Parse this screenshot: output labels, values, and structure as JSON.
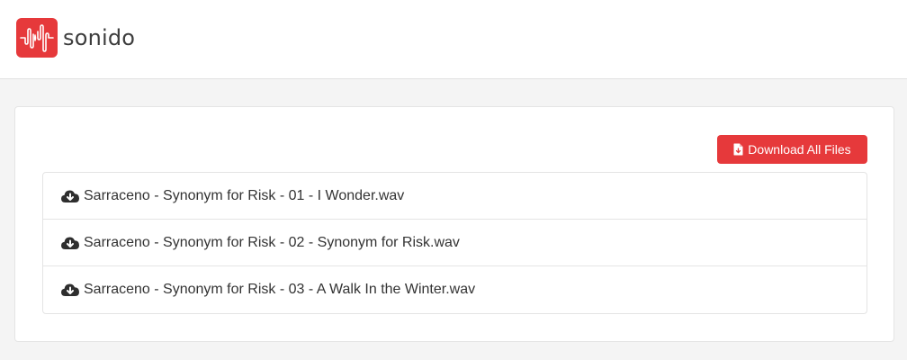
{
  "brand": {
    "name": "sonido",
    "accent_color": "#e6393b"
  },
  "actions": {
    "download_all_label": "Download All Files",
    "download_all_icon": "file-icon"
  },
  "files": [
    {
      "name": "Sarraceno - Synonym for Risk - 01 - I Wonder.wav",
      "icon": "cloud-download-icon"
    },
    {
      "name": "Sarraceno - Synonym for Risk - 02 - Synonym for Risk.wav",
      "icon": "cloud-download-icon"
    },
    {
      "name": "Sarraceno - Synonym for Risk - 03 - A Walk In the Winter.wav",
      "icon": "cloud-download-icon"
    }
  ]
}
